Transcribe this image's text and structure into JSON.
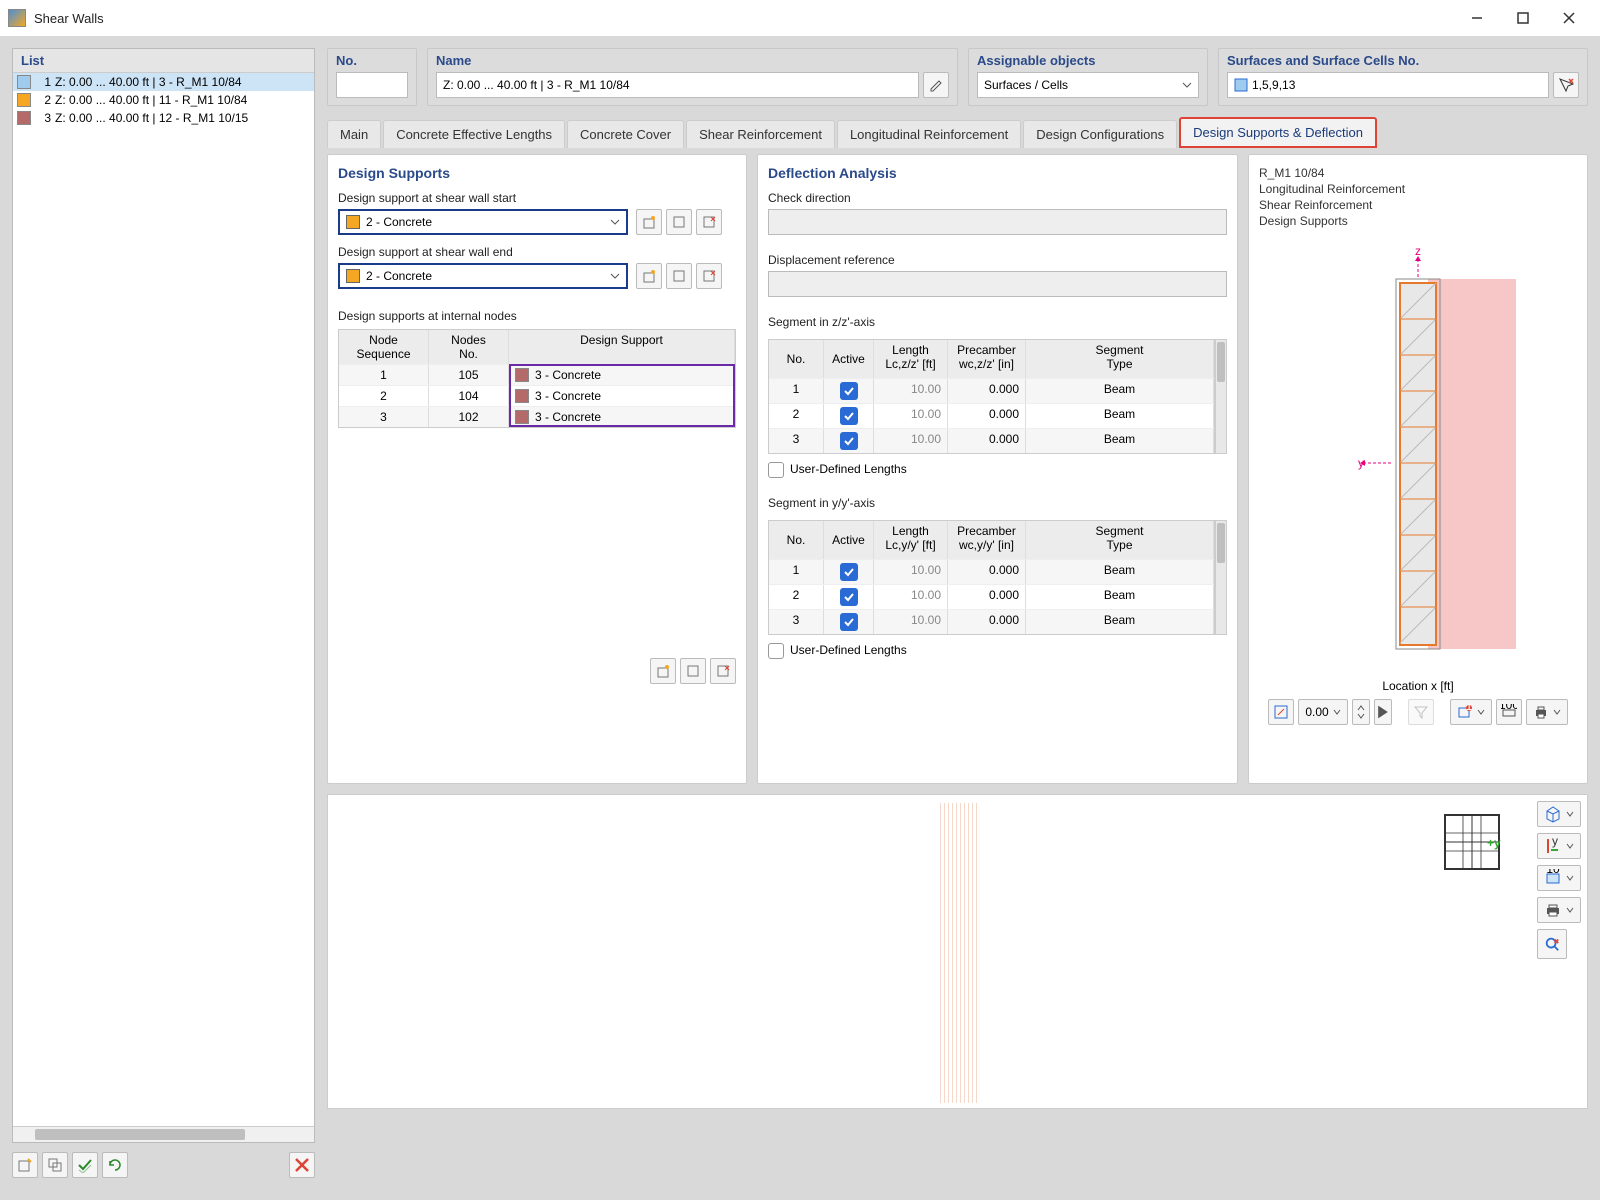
{
  "window": {
    "title": "Shear Walls"
  },
  "list": {
    "header": "List",
    "items": [
      {
        "n": "1",
        "text": "Z: 0.00 ... 40.00 ft | 3 - R_M1 10/84",
        "color": "#9fccee",
        "selected": true
      },
      {
        "n": "2",
        "text": "Z: 0.00 ... 40.00 ft | 11 - R_M1 10/84",
        "color": "#f5a623",
        "selected": false
      },
      {
        "n": "3",
        "text": "Z: 0.00 ... 40.00 ft | 12 - R_M1 10/15",
        "color": "#b56a6a",
        "selected": false
      }
    ]
  },
  "fields": {
    "no_label": "No.",
    "no_value": "",
    "name_label": "Name",
    "name_value": "Z: 0.00 ... 40.00  ft | 3 - R_M1 10/84",
    "assignable_label": "Assignable objects",
    "assignable_value": "Surfaces / Cells",
    "surfaces_label": "Surfaces and Surface Cells No.",
    "surfaces_value": "1,5,9,13"
  },
  "tabs": [
    "Main",
    "Concrete Effective Lengths",
    "Concrete Cover",
    "Shear Reinforcement",
    "Longitudinal Reinforcement",
    "Design Configurations",
    "Design Supports & Deflection"
  ],
  "active_tab": 6,
  "design_supports": {
    "title": "Design Supports",
    "start_label": "Design support at shear wall start",
    "start_value": "2 - Concrete",
    "start_color": "#f5a623",
    "end_label": "Design support at shear wall end",
    "end_value": "2 - Concrete",
    "end_color": "#f5a623",
    "internal_label": "Design supports at internal nodes",
    "cols": {
      "seq": "Node\nSequence",
      "nodes": "Nodes\nNo.",
      "design": "Design Support"
    },
    "rows": [
      {
        "seq": "1",
        "node": "105",
        "design": "3 - Concrete",
        "color": "#b56a6a"
      },
      {
        "seq": "2",
        "node": "104",
        "design": "3 - Concrete",
        "color": "#b56a6a"
      },
      {
        "seq": "3",
        "node": "102",
        "design": "3 - Concrete",
        "color": "#b56a6a"
      }
    ]
  },
  "deflection": {
    "title": "Deflection Analysis",
    "check_dir_label": "Check direction",
    "disp_ref_label": "Displacement reference",
    "seg_z_label": "Segment in z/z'-axis",
    "seg_y_label": "Segment in y/y'-axis",
    "udl_label": "User-Defined Lengths",
    "z_cols": {
      "no": "No.",
      "active": "Active",
      "len": "Length\nLc,z/z' [ft]",
      "pre": "Precamber\nwc,z/z' [in]",
      "seg": "Segment\nType"
    },
    "y_cols": {
      "no": "No.",
      "active": "Active",
      "len": "Length\nLc,y/y' [ft]",
      "pre": "Precamber\nwc,y/y' [in]",
      "seg": "Segment\nType"
    },
    "z_rows": [
      {
        "no": "1",
        "active": true,
        "len": "10.00",
        "pre": "0.000",
        "seg": "Beam"
      },
      {
        "no": "2",
        "active": true,
        "len": "10.00",
        "pre": "0.000",
        "seg": "Beam"
      },
      {
        "no": "3",
        "active": true,
        "len": "10.00",
        "pre": "0.000",
        "seg": "Beam"
      }
    ],
    "y_rows": [
      {
        "no": "1",
        "active": true,
        "len": "10.00",
        "pre": "0.000",
        "seg": "Beam"
      },
      {
        "no": "2",
        "active": true,
        "len": "10.00",
        "pre": "0.000",
        "seg": "Beam"
      },
      {
        "no": "3",
        "active": true,
        "len": "10.00",
        "pre": "0.000",
        "seg": "Beam"
      }
    ]
  },
  "preview": {
    "lines": [
      "R_M1 10/84",
      "Longitudinal Reinforcement",
      "Shear Reinforcement",
      "Design Supports"
    ],
    "axis_z": "z",
    "axis_y": "y",
    "location_label": "Location x [ft]",
    "location_value": "0.00"
  },
  "viewport": {
    "axis_label": "+y"
  }
}
